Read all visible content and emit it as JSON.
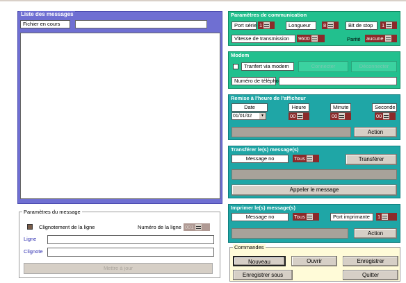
{
  "liste": {
    "title": "Liste des messages",
    "fichier_label": "Fichier en cours",
    "fichier_value": ""
  },
  "params_message": {
    "title": "Paramètres du message",
    "clignotement_label": "Clignotement de la ligne",
    "numero_ligne_label": "Numéro de la ligne",
    "numero_ligne_value": "001",
    "ligne_label": "Ligne",
    "ligne_value": "",
    "clignote_label": "Clignote",
    "clignote_value": "",
    "mettre_a_jour": "Mettre à jour"
  },
  "communication": {
    "title": "Paramètres de communication",
    "port_serie_label": "Port série",
    "port_serie_value": "1",
    "longueur_label": "Longueur",
    "longueur_value": "8",
    "bit_stop_label": "Bit de stop",
    "bit_stop_value": "1",
    "vitesse_label": "Vitesse de transmission",
    "vitesse_value": "9600",
    "parite_label": "Parité",
    "parite_value": "aucune"
  },
  "modem": {
    "title": "Modem",
    "transfert_label": "Tranfert via modem",
    "connecter": "Connecter",
    "deconnecter": "Déconnecter",
    "tel_label": "Numéro de téléphone",
    "tel_value": ""
  },
  "remise": {
    "title": "Remise à l'heure de l'afficheur",
    "date_label": "Date",
    "date_value": "01/01/02",
    "heure_label": "Heure",
    "heure_value": "00",
    "minute_label": "Minute",
    "minute_value": "00",
    "seconde_label": "Seconde",
    "seconde_value": "00",
    "action": "Action"
  },
  "transferer": {
    "title": "Transférer le(s) message(s)",
    "message_no_label": "Message no",
    "message_no_value": "Tous",
    "transferer_btn": "Transférer",
    "appeler_btn": "Appeler le  message"
  },
  "imprimer": {
    "title": "Imprimer le(s) message(s)",
    "message_no_label": "Message no",
    "message_no_value": "Tous",
    "port_label": "Port imprimante",
    "port_value": "1",
    "action": "Action"
  },
  "commandes": {
    "title": "Commandes",
    "nouveau": "Nouveau",
    "ouvrir": "Ouvrir",
    "enregistrer": "Enregistrer",
    "enregistrer_sous": "Enregistrer sous",
    "quitter": "Quitter"
  },
  "colors": {
    "left_panel": "#6f6fd2",
    "green_panel": "#22c08e",
    "teal_panel": "#1fa6a6",
    "spin_bg": "#8b2a2a",
    "commands_bg": "#fffbd8"
  }
}
